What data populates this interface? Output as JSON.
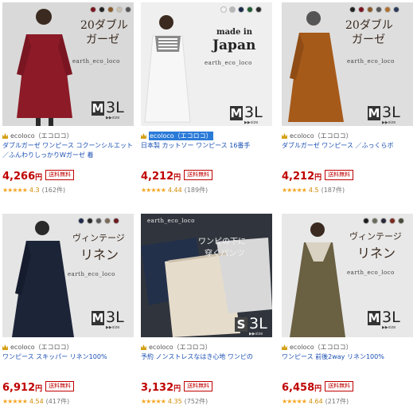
{
  "products": [
    {
      "shop": "ecoloco（エコロコ）",
      "title": "ダブルガーゼ ワンピース コクーンシルエット ／ふんわりしっかりWガーゼ 着",
      "price": "4,266",
      "yen": "円",
      "shipping": "送料無料",
      "stars": "★★★★★",
      "score": "4.3",
      "reviews": "(162件)",
      "overlay": [
        "20ダブル",
        "ガーゼ"
      ],
      "brand": "earth_eco_loco",
      "size_m": "M",
      "size_3l": "3L",
      "size_sub": "▶▶size",
      "dot_colors": [
        "#7a1520",
        "#222222",
        "#8a5a2a",
        "#c9c0b0",
        "#555555"
      ],
      "bg": "#d7d7d7",
      "dress": "#8c1a27"
    },
    {
      "shop": "ecoloco（エコロコ）",
      "title": "日本製 カットソー ワンピース 16番手",
      "price": "4,212",
      "yen": "円",
      "shipping": "送料無料",
      "stars": "★★★★★",
      "score": "4.44",
      "reviews": "(189件)",
      "overlay": [
        "made in",
        "Japan"
      ],
      "brand": "earth_eco_loco",
      "size_m": "M",
      "size_3l": "3L",
      "size_sub": "▶▶size",
      "dot_colors": [
        "#f2f2f2",
        "#b8b8b8",
        "#1b2a4a",
        "#1e5a32",
        "#2c2c2c"
      ],
      "bg": "#eeeeee",
      "dress": "#f5f5f5"
    },
    {
      "shop": "ecoloco（エコロコ）",
      "title": "ダブルガーゼ ワンピース ／ふっくらボ",
      "price": "4,212",
      "yen": "円",
      "shipping": "送料無料",
      "stars": "★★★★★",
      "score": "4.5",
      "reviews": "(187件)",
      "overlay": [
        "20ダブル",
        "ガーゼ"
      ],
      "brand": "earth_eco_loco",
      "size_m": "M",
      "size_3l": "3L",
      "size_sub": "▶▶size",
      "dot_colors": [
        "#222222",
        "#7a1520",
        "#8a5a2a",
        "#555555",
        "#b07030",
        "#2a3a5a"
      ],
      "bg": "#dcdcdc",
      "dress": "#a65a1a"
    },
    {
      "shop": "ecoloco（エコロコ）",
      "title": "ワンピース スキッパー リネン100%",
      "price": "6,912",
      "yen": "円",
      "shipping": "送料無料",
      "stars": "★★★★★",
      "score": "4.54",
      "reviews": "(417件)",
      "overlay": [
        "ヴィンテージ",
        "リネン"
      ],
      "brand": "earth_eco_loco",
      "size_m": "M",
      "size_3l": "3L",
      "size_sub": "▶▶size",
      "dot_colors": [
        "#1e2a4a",
        "#2a2a2a",
        "#5a5a5a",
        "#7a6a5a",
        "#6a1a20"
      ],
      "bg": "#e4e4e4",
      "dress": "#1c2438"
    },
    {
      "shop": "ecoloco（エコロコ）",
      "title": "予約 ノンストレスなはき心地 ワンピの",
      "price": "3,132",
      "yen": "円",
      "shipping": "送料無料",
      "stars": "★★★★★",
      "score": "4.35",
      "reviews": "(752件)",
      "overlay": [
        "ワンピの下に",
        "穿くパンツ"
      ],
      "brand": "earth_eco_loco",
      "size_m": "S",
      "size_3l": "3L",
      "size_sub": "▶▶size",
      "dot_colors": [],
      "bg": "#2a2f38",
      "dress": "#22304a"
    },
    {
      "shop": "ecoloco（エコロコ）",
      "title": "ワンピース 前後2way リネン100%",
      "price": "6,458",
      "yen": "円",
      "shipping": "送料無料",
      "stars": "★★★★★",
      "score": "4.64",
      "reviews": "(217件)",
      "overlay": [
        "ヴィンテージ",
        "リネン"
      ],
      "brand": "earth_eco_loco",
      "size_m": "M",
      "size_3l": "3L",
      "size_sub": "▶▶size",
      "dot_colors": [
        "#1e1e1e",
        "#6a6a5a",
        "#2a2a3a",
        "#7a2a20",
        "#4a4a3a"
      ],
      "bg": "#e6e6e6",
      "dress": "#6a6042"
    }
  ]
}
